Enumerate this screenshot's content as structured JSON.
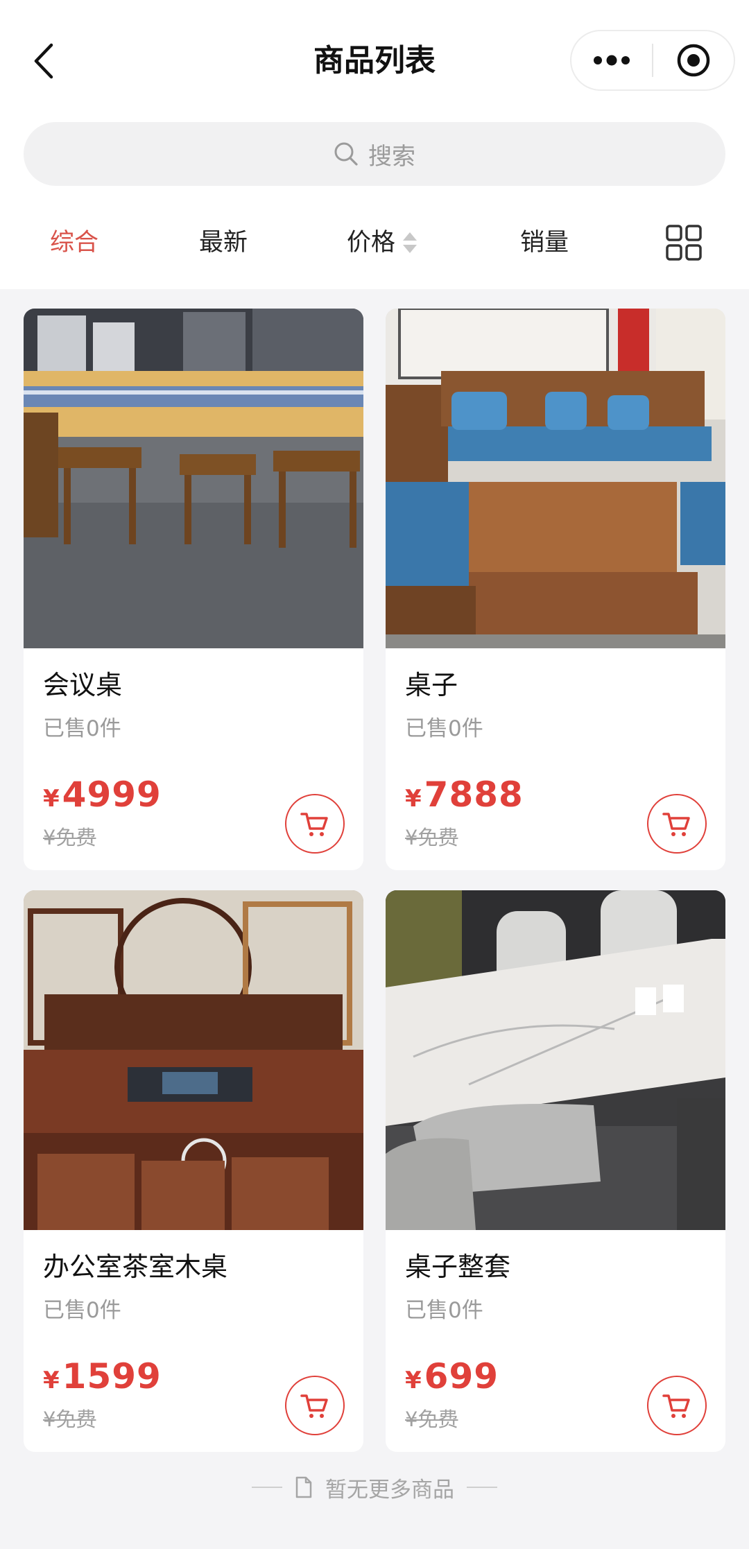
{
  "header": {
    "title": "商品列表",
    "back_icon": "chevron-left-icon",
    "more_icon": "more-dots-icon",
    "close_icon": "target-circle-icon"
  },
  "search": {
    "placeholder": "搜索",
    "icon": "search-icon"
  },
  "sort": {
    "items": [
      {
        "label": "综合",
        "active": true
      },
      {
        "label": "最新",
        "active": false
      },
      {
        "label": "价格",
        "active": false,
        "icon": "sort-arrows-icon"
      },
      {
        "label": "销量",
        "active": false
      }
    ],
    "layout_icon": "grid-layout-icon"
  },
  "colors": {
    "accent": "#e0403a",
    "active_tab": "#d9534a",
    "background": "#f4f4f6"
  },
  "products": [
    {
      "name": "会议桌",
      "sold": "已售0件",
      "currency": "¥",
      "price": "4999",
      "original": "¥免费",
      "photo": "long wooden conference table with stools"
    },
    {
      "name": "桌子",
      "sold": "已售0件",
      "currency": "¥",
      "price": "7888",
      "original": "¥免费",
      "photo": "wooden sofa set with blue cushions and coffee table"
    },
    {
      "name": "办公室茶室木桌",
      "sold": "已售0件",
      "currency": "¥",
      "price": "1599",
      "original": "¥免费",
      "photo": "dark wood tea table with shelving"
    },
    {
      "name": "桌子整套",
      "sold": "已售0件",
      "currency": "¥",
      "price": "699",
      "original": "¥免费",
      "photo": "white marble table with chairs"
    }
  ],
  "footer": {
    "text": "暂无更多商品",
    "icon": "document-icon"
  }
}
